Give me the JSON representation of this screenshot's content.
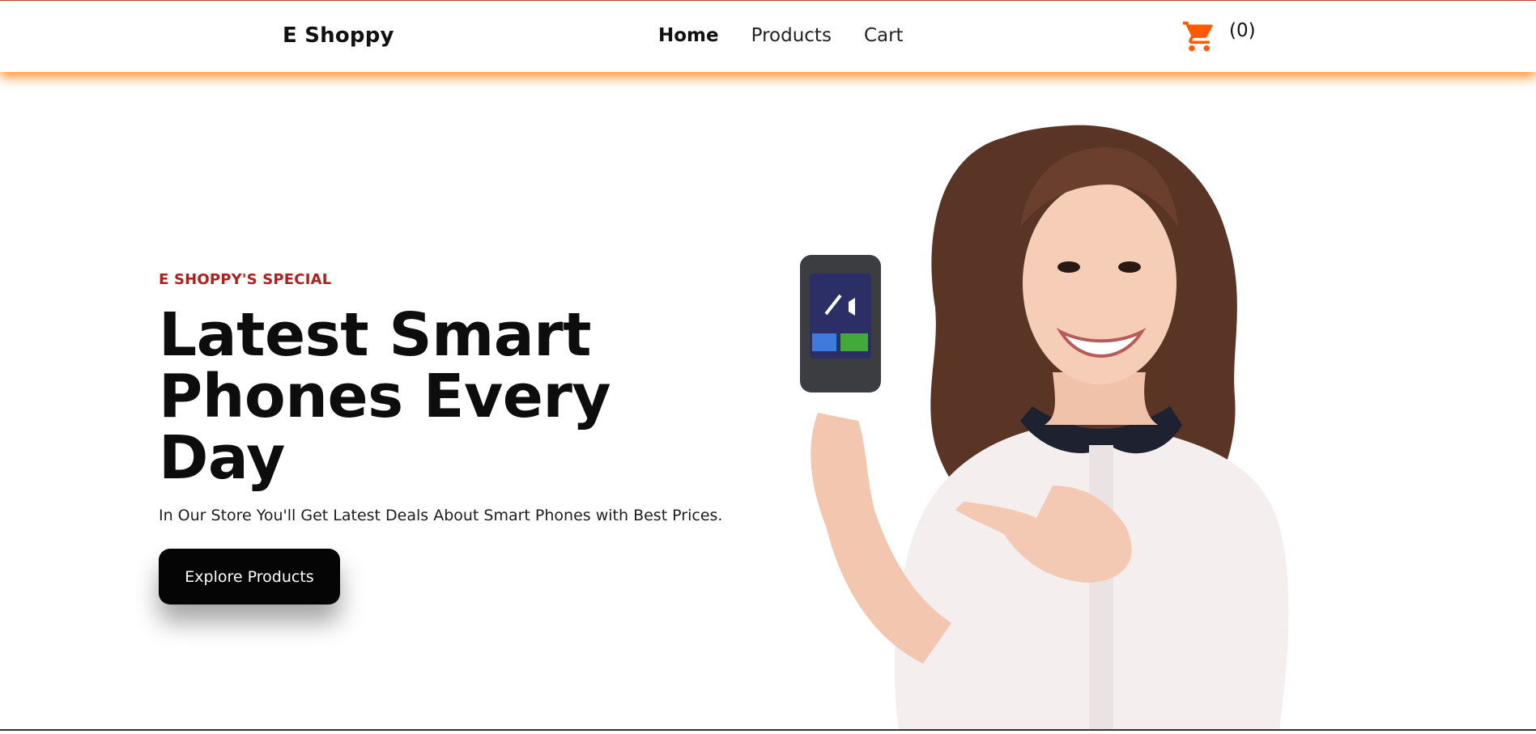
{
  "header": {
    "brand": "E Shoppy",
    "nav": [
      {
        "label": "Home",
        "active": true
      },
      {
        "label": "Products",
        "active": false
      },
      {
        "label": "Cart",
        "active": false
      }
    ],
    "cart_count": "(0)",
    "cart_icon": "cart-icon",
    "accent_color": "#ff5a00"
  },
  "hero": {
    "eyebrow": "E SHOPPY'S SPECIAL",
    "headline": "Latest Smart Phones Every Day",
    "subtext": "In Our Store You'll Get Latest Deals About Smart Phones with Best Prices.",
    "cta_label": "Explore Products",
    "eyebrow_color": "#b01e1e"
  }
}
